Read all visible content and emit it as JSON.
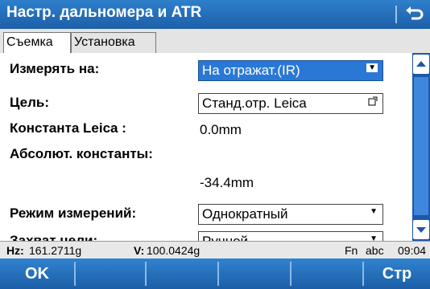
{
  "window": {
    "title": "Настр. дальномера и ATR",
    "back_icon": "back-arrow-icon"
  },
  "tabs": [
    {
      "label": "Съемка",
      "active": true
    },
    {
      "label": "Установка",
      "active": false
    }
  ],
  "fields": {
    "measure_on": {
      "label": "Измерять на:",
      "value": "На отражат.(IR)"
    },
    "target": {
      "label": "Цель:",
      "value": "Станд.отр. Leica"
    },
    "leica_constant": {
      "label": "Константа Leica :",
      "value": "0.0mm"
    },
    "absolute_constant": {
      "label": "Абсолют. константы:",
      "value": "-34.4mm"
    },
    "measure_mode": {
      "label": "Режим измерений:",
      "value": "Однократный"
    },
    "target_capture": {
      "label": "Захват цели:",
      "value": "Ручной"
    }
  },
  "status": {
    "hz_label": "Hz:",
    "hz_value": "161.2711g",
    "v_label": "V:",
    "v_value": "100.0424g",
    "fn": "Fn",
    "input_mode": "abc",
    "time": "09:04"
  },
  "softkeys": {
    "f1": "OK",
    "f6": "Стр"
  }
}
